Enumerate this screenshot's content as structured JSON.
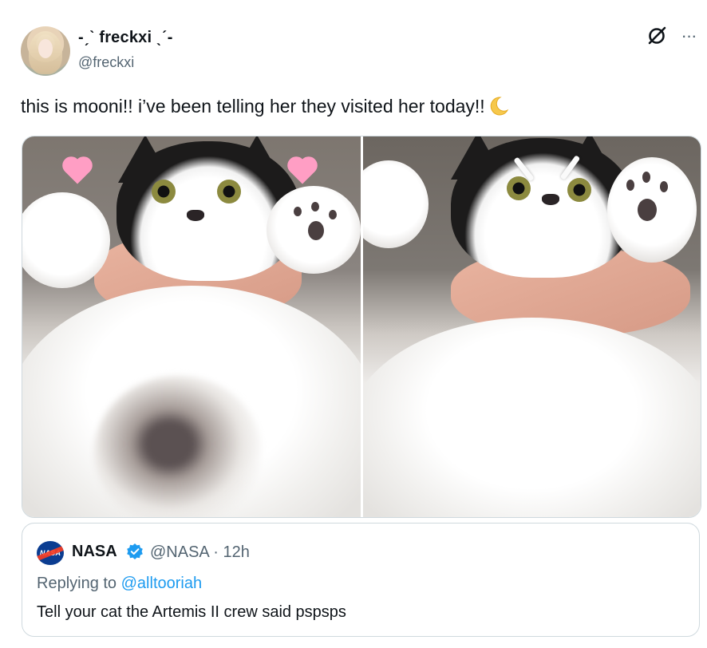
{
  "author": {
    "display_name": "-ˏˋ freckxi ˎˊ-",
    "handle": "@freckxi",
    "avatar_icon": "profile-photo"
  },
  "header_icons": {
    "grok": "grok-icon",
    "more": "more-icon",
    "more_label": "···"
  },
  "tweet": {
    "text": "this is mooni!! i’ve been telling her they visited her today!!",
    "emoji": "crescent-moon"
  },
  "media": {
    "photos": [
      {
        "alt_icon": "cat-photo-hearts"
      },
      {
        "alt_icon": "cat-photo-eyebrows"
      }
    ]
  },
  "quote": {
    "name": "NASA",
    "verified": true,
    "handle": "@NASA",
    "separator": "·",
    "time": "12h",
    "replying_prefix": "Replying to ",
    "replying_to": "@alltooriah",
    "text": "Tell your cat the Artemis II crew said pspsps",
    "logo_text": "NASA"
  },
  "colors": {
    "text_primary": "#0f1419",
    "text_secondary": "#536471",
    "link": "#1d9bf0",
    "border": "#cfd9de",
    "verified": "#1d9bf0"
  }
}
